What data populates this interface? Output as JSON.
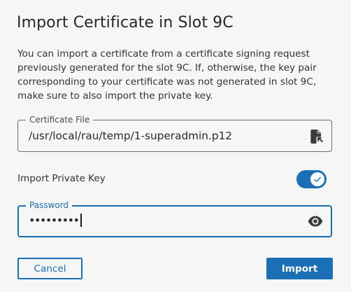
{
  "dialog": {
    "title": "Import Certificate in Slot 9C",
    "description": "You can import a certificate from a certificate signing request previously generated for the slot 9C. If, otherwise, the key pair corresponding to your certificate was not generated in slot 9C, make sure to also import the private key."
  },
  "certificate_file": {
    "label": "Certificate File",
    "value": "/usr/local/rau/temp/1-superadmin.p12",
    "icon": "file-icon"
  },
  "import_private_key": {
    "label": "Import Private Key",
    "enabled": true,
    "icon": "check-icon"
  },
  "password": {
    "label": "Password",
    "masked_value": "•••••••••",
    "icon": "eye-icon"
  },
  "buttons": {
    "cancel": "Cancel",
    "import": "Import"
  },
  "colors": {
    "accent": "#1a6fb5",
    "background": "#f6f6f6",
    "text": "#2a2a2a"
  }
}
